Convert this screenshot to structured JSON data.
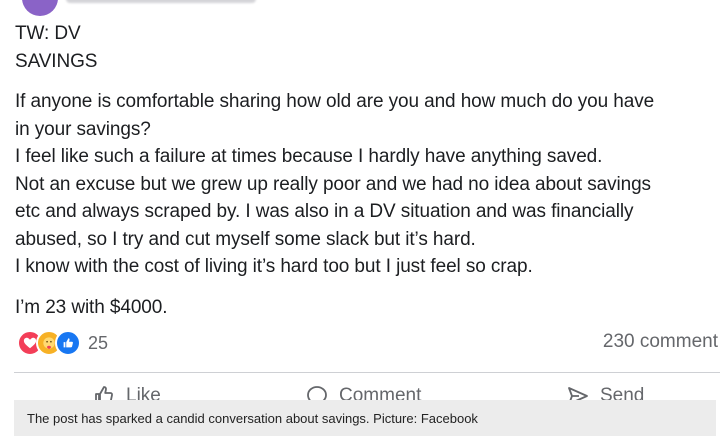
{
  "post": {
    "lines": [
      "TW: DV",
      "SAVINGS",
      "If anyone is comfortable sharing how old are you and how much do you have",
      "in your savings?",
      "I feel like such a failure at times because I hardly have anything saved.",
      "Not an excuse but we grew up really poor and we had no idea about savings",
      "etc and always scraped by. I was also in a DV situation and was financially",
      "abused, so I try and cut myself some slack but it’s hard.",
      "I know with the cost of living it’s hard too but I just feel so crap.",
      "I’m 23 with $4000."
    ]
  },
  "reactions": {
    "types": [
      "love-icon",
      "care-icon",
      "like-icon"
    ],
    "count": "25"
  },
  "comments_label": "230 comment",
  "actions": {
    "like": "Like",
    "comment": "Comment",
    "send": "Send"
  },
  "caption": "The post has sparked a candid conversation about savings. Picture: Facebook",
  "colors": {
    "love": "#f33e58",
    "care": "#f7b125",
    "like": "#1877f2",
    "muted_text": "#65676b"
  }
}
